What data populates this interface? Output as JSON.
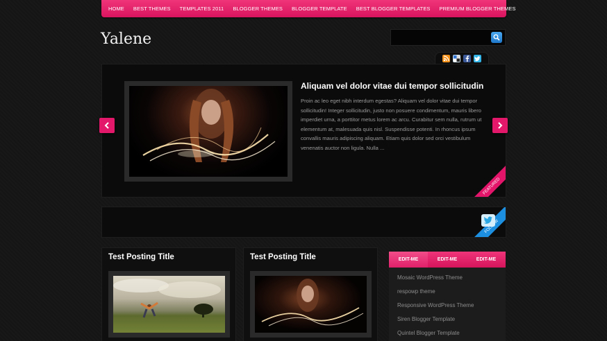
{
  "nav": {
    "items": [
      "HOME",
      "BEST THEMES",
      "TEMPLATES 2011",
      "BLOGGER THEMES",
      "BLOGGER TEMPLATE",
      "BEST BLOGGER TEMPLATES",
      "PREMIUM BLOGGER THEMES"
    ]
  },
  "header": {
    "logo": "Yalene",
    "search_placeholder": ""
  },
  "social": [
    "rss-icon",
    "delicious-icon",
    "facebook-icon",
    "twitter-icon"
  ],
  "featured": {
    "title": "Aliquam vel dolor vitae dui tempor sollicitudin",
    "text": "Proin ac leo eget nibh interdum egestas? Aliquam vel dolor vitae dui tempor sollicitudin! Integer sollicitudin, justo non posuere condimentum, mauris libero imperdiet urna, a porttitor metus lorem ac arcu. Curabitur sem nulla, rutrum ut elementum at, malesuada quis nisl. Suspendisse potenti. In rhoncus ipsum convallis mauris adipiscing aliquam. Etiam quis dolor sed orci vestibulum venenatis auctor non ligula. Nulla ...",
    "ribbon": "FEATURED"
  },
  "follow": {
    "ribbon": "FOLLOW"
  },
  "posts": [
    {
      "title": "Test Posting Title"
    },
    {
      "title": "Test Posting Title"
    }
  ],
  "sidebar": {
    "tabs": [
      "EDIT-ME",
      "EDIT-ME",
      "EDIT-ME"
    ],
    "items": [
      "Mosaic WordPress Theme",
      "respowp theme",
      "Responsive WordPress Theme",
      "Siren Blogger Template",
      "Quintel Blogger Template"
    ]
  },
  "colors": {
    "accent": "#e4186a",
    "follow_blue": "#1d8fe0",
    "background": "#151515"
  }
}
